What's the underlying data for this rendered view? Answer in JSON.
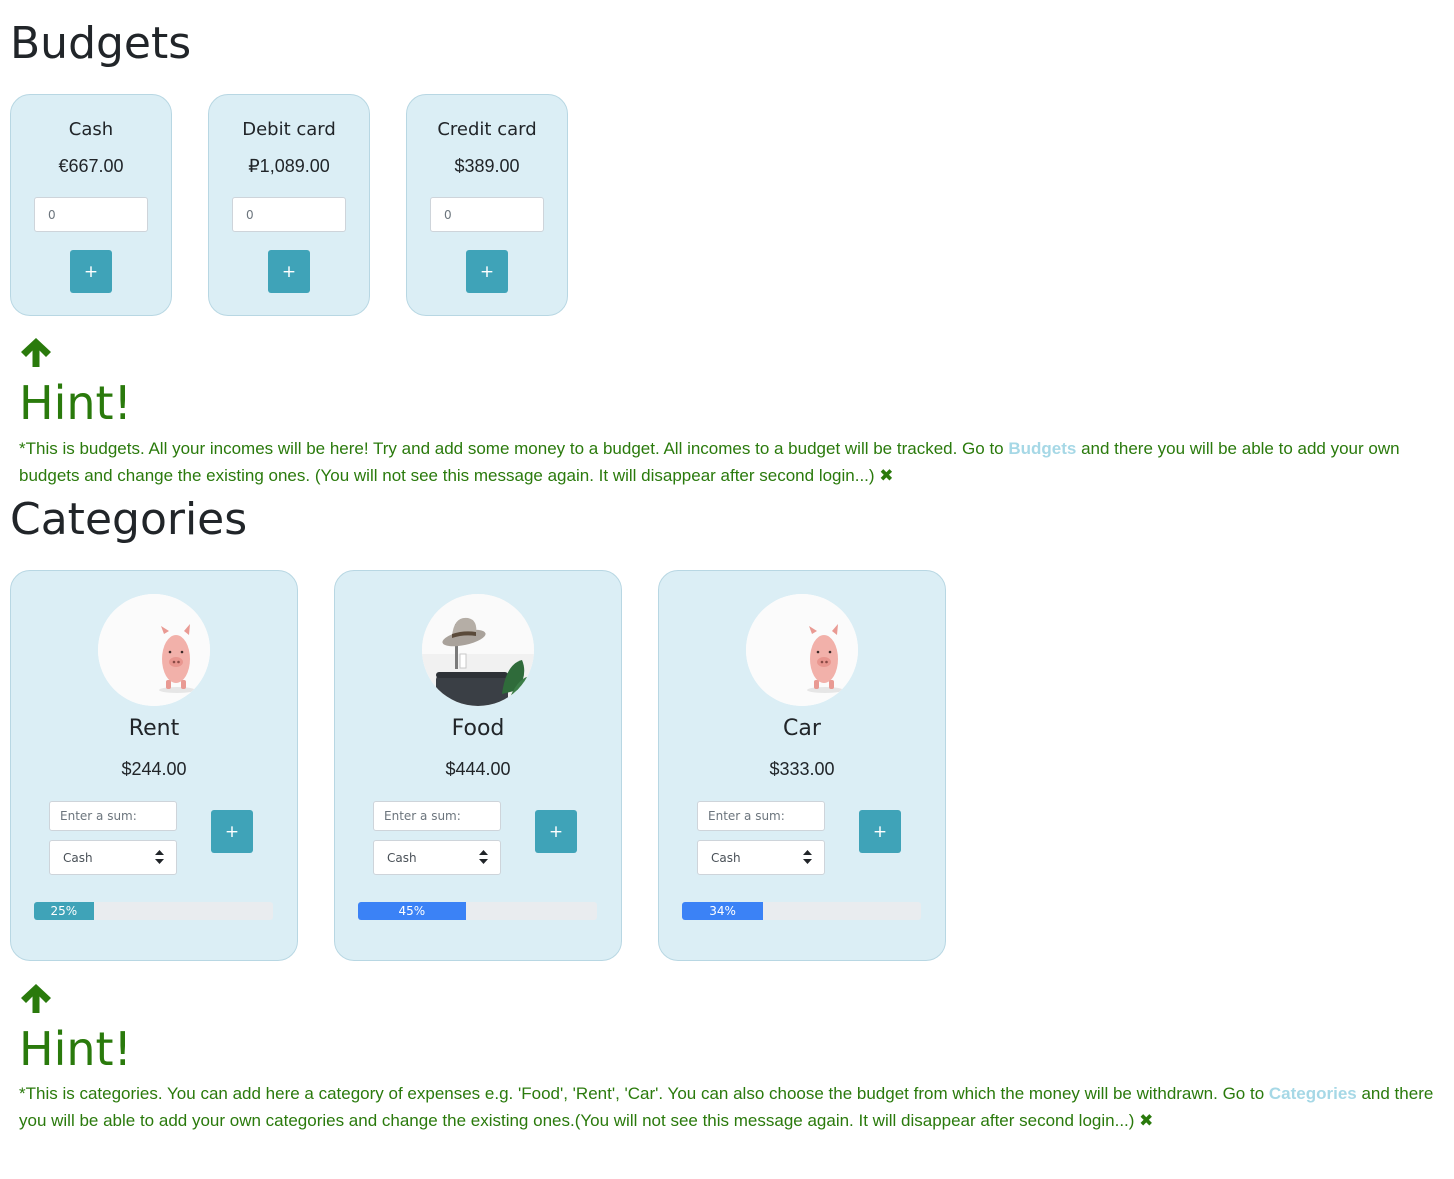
{
  "budgets": {
    "title": "Budgets",
    "items": [
      {
        "name": "Cash",
        "amount": "€667.00",
        "input_value": "0",
        "add_label": "+"
      },
      {
        "name": "Debit card",
        "amount": "₽1,089.00",
        "input_value": "0",
        "add_label": "+"
      },
      {
        "name": "Credit card",
        "amount": "$389.00",
        "input_value": "0",
        "add_label": "+"
      }
    ],
    "hint": {
      "title": "Hint!",
      "text_before": "*This is budgets. All your incomes will be here! Try and add some money to a budget. All incomes to a budget will be tracked. Go to ",
      "link": "Budgets",
      "text_after": " and there you will be able to add your own budgets and change the existing ones. (You will not see this message again. It will disappear after second login...) ",
      "close": "✖"
    }
  },
  "categories": {
    "title": "Categories",
    "items": [
      {
        "name": "Rent",
        "amount": "$244.00",
        "image": "piggy-bank",
        "placeholder": "Enter a sum:",
        "budget": "Cash",
        "add_label": "+",
        "progress": 25,
        "progress_label": "25%",
        "progress_color": "#3fa3b8"
      },
      {
        "name": "Food",
        "amount": "$444.00",
        "image": "hat-and-luggage",
        "placeholder": "Enter a sum:",
        "budget": "Cash",
        "add_label": "+",
        "progress": 45,
        "progress_label": "45%",
        "progress_color": "#3b82f6"
      },
      {
        "name": "Car",
        "amount": "$333.00",
        "image": "piggy-bank",
        "placeholder": "Enter a sum:",
        "budget": "Cash",
        "add_label": "+",
        "progress": 34,
        "progress_label": "34%",
        "progress_color": "#3b82f6"
      }
    ],
    "hint": {
      "title": "Hint!",
      "text_before": "*This is categories. You can add here a category of expenses e.g. 'Food', 'Rent', 'Car'. You can also choose the budget from which the money will be withdrawn. Go to ",
      "link": "Categories",
      "text_after": " and there you will be able to add your own categories and change the existing ones.(You will not see this message again. It will disappear after second login...) ",
      "close": "✖"
    }
  },
  "colors": {
    "card_bg": "#dbeef5",
    "button": "#3fa3b8",
    "hint_green": "#2a7a0c",
    "link": "#a6d8e6"
  }
}
